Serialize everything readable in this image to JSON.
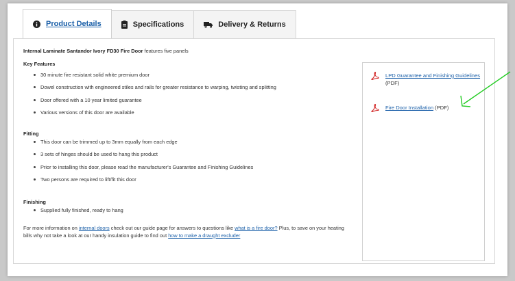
{
  "tabs": [
    {
      "label": "Product Details",
      "icon": "info-icon"
    },
    {
      "label": "Specifications",
      "icon": "clipboard-icon"
    },
    {
      "label": "Delivery & Returns",
      "icon": "truck-icon"
    }
  ],
  "intro": {
    "bold": "Internal Laminate Santandor Ivory FD30 Fire Door",
    "rest": " features five panels"
  },
  "key_features": {
    "title": "Key Features",
    "items": [
      "30 minute fire resistant solid white premium door",
      "Dowel construction with engineered stiles and rails for greater resistance to warping, twisting and splitting",
      "Door offered with a 10 year limited guarantee",
      "Various versions of this door are available"
    ]
  },
  "fitting": {
    "title": "Fitting",
    "items": [
      "This door can be trimmed up to 3mm equally from each edge",
      "3 sets of hinges should be used to hang this product",
      "Prior to installing this door, please read the manufacturer's Guarantee and Finishing Guidelines",
      "Two persons are required to lift/fit this door"
    ]
  },
  "finishing": {
    "title": "Finishing",
    "items": [
      "Supplied fully finished, ready to hang"
    ]
  },
  "more_info": {
    "t1": "For more information on ",
    "link1": "internal doors",
    "t2": " check out our guide page for answers to questions like ",
    "link2": "what is a fire door?",
    "t3": " Plus, to save on your heating bills why not take a look at our handy insulation guide to find out ",
    "link3": "how to make a draught excluder"
  },
  "documents": [
    {
      "link": "LPD Guarantee and Finishing Guidelines",
      "suffix": " (PDF)",
      "icon": "pdf-icon"
    },
    {
      "link": "Fire Door Installation",
      "suffix": " (PDF)",
      "icon": "pdf-icon"
    }
  ],
  "colors": {
    "link": "#1a5fa8",
    "pdf_red": "#d32b2b",
    "annotation_arrow": "#22cc22"
  }
}
